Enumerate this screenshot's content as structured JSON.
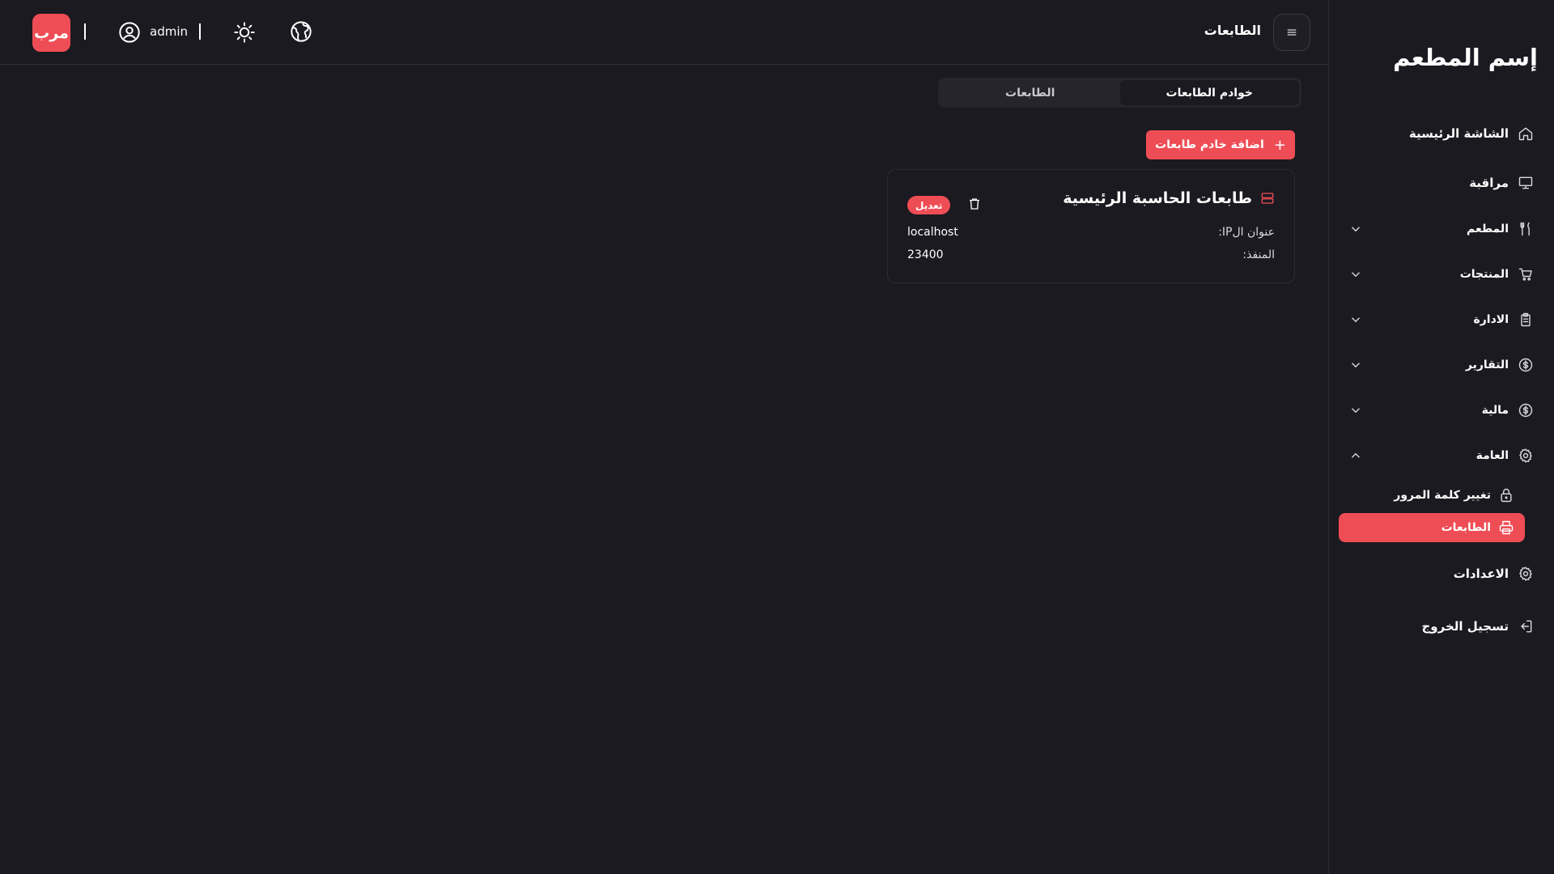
{
  "sidebar": {
    "brand": "إسم المطعم",
    "items": [
      {
        "label": "الشاشة الرئيسية",
        "icon": "home-icon"
      },
      {
        "label": "مراقبة",
        "icon": "monitor-icon"
      },
      {
        "label": "المطعم",
        "icon": "utensils-icon"
      },
      {
        "label": "المنتجات",
        "icon": "cart-icon"
      },
      {
        "label": "الادارة",
        "icon": "clipboard-icon"
      },
      {
        "label": "التقارير",
        "icon": "dollar-icon"
      },
      {
        "label": "مالية",
        "icon": "dollar-icon"
      },
      {
        "label": "العامة",
        "icon": "gear-icon"
      },
      {
        "label": "الاعدادات",
        "icon": "gear-icon"
      },
      {
        "label": "تسجيل الخروج",
        "icon": "logout-icon"
      }
    ],
    "sub_items": [
      {
        "label": "تغيير كلمة المرور",
        "icon": "lock-icon"
      },
      {
        "label": "الطابعات",
        "icon": "printer-icon",
        "active": true
      }
    ]
  },
  "header": {
    "title": "الطابعات",
    "logo_text": "مرب",
    "username": "admin"
  },
  "tabs": [
    {
      "label": "خوادم الطابعات",
      "active": true
    },
    {
      "label": "الطابعات",
      "active": false
    }
  ],
  "add_button": "اضافة خادم طابعات",
  "card": {
    "title": "طابعات الحاسبة الرئيسية",
    "edit_label": "تعديل",
    "ip_label": "عنوان الIP:",
    "ip_value": "localhost",
    "port_label": "المنفذ:",
    "port_value": "23400"
  },
  "colors": {
    "accent": "#ef4d55",
    "background": "#1b1a20",
    "tab_track": "#26252b"
  }
}
